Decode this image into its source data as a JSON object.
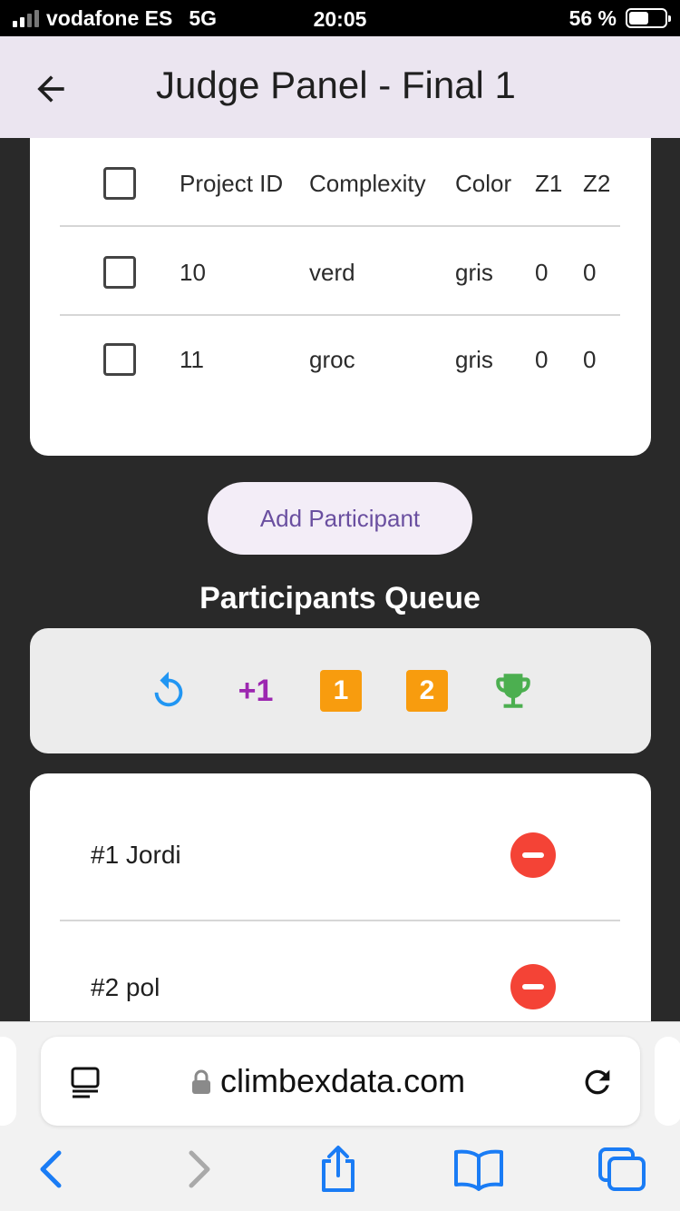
{
  "status_bar": {
    "carrier": "vodafone ES",
    "network": "5G",
    "time": "20:05",
    "battery": "56 %",
    "battery_level": 0.56
  },
  "app_bar": {
    "title": "Judge Panel - Final 1",
    "back_icon": "arrow-left-icon"
  },
  "table": {
    "headers": [
      "Project ID",
      "Complexity",
      "Color",
      "Z1",
      "Z2"
    ],
    "rows": [
      [
        "10",
        "verd",
        "gris",
        "0",
        "0"
      ],
      [
        "11",
        "groc",
        "gris",
        "0",
        "0"
      ]
    ]
  },
  "add_button": {
    "label": "Add Participant"
  },
  "queue": {
    "title": "Participants Queue",
    "toolbar": {
      "undo_icon": "undo-icon",
      "plus_one": "+1",
      "badge_one": "1",
      "badge_two": "2",
      "trophy_icon": "trophy-icon"
    },
    "items": [
      {
        "label": "#1 Jordi"
      },
      {
        "label": "#2 pol"
      }
    ]
  },
  "browser": {
    "url": "climbexdata.com"
  },
  "colors": {
    "accent_purple": "#6a4fa0",
    "remove_red": "#f44336",
    "badge_orange": "#f89c0e",
    "trophy_green": "#4caf50",
    "undo_blue": "#2196f3",
    "ios_blue": "#1a7cf5"
  }
}
